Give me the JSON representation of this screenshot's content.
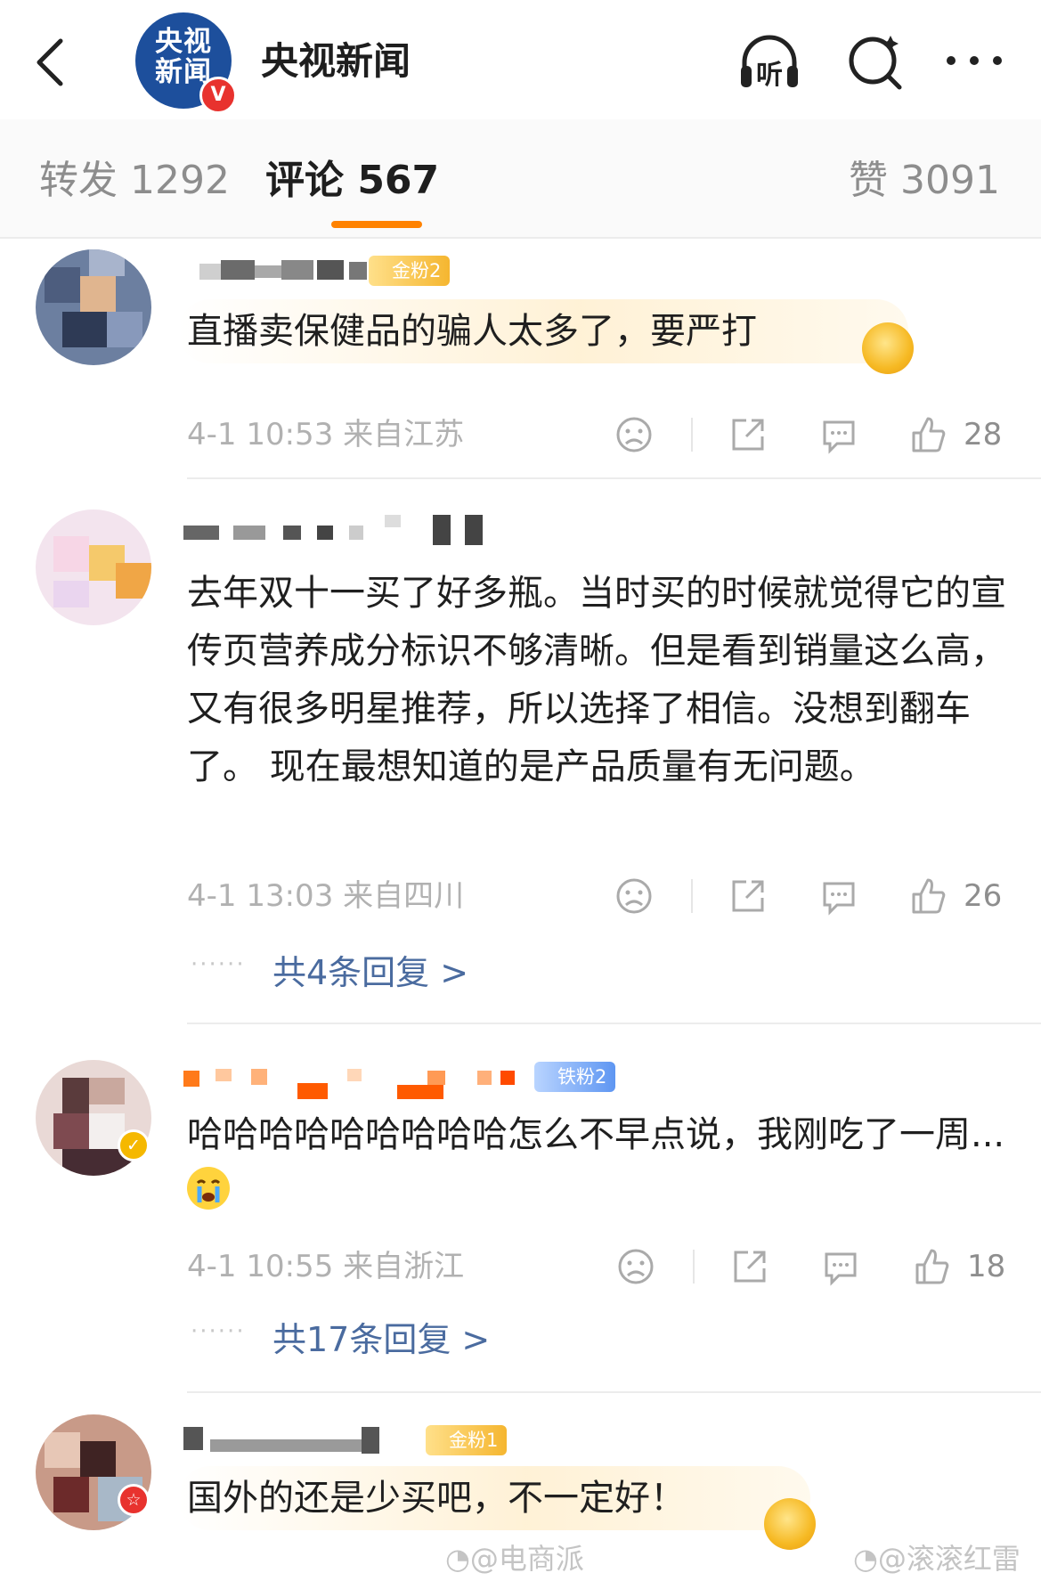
{
  "header": {
    "logo_text_line1": "央视",
    "logo_text_line2": "新闻",
    "verified_mark": "V",
    "channel_name": "央视新闻",
    "listen_label": "听"
  },
  "tabs": {
    "repost": "转发 1292",
    "comments": "评论 567",
    "likes": "赞 3091"
  },
  "comments": [
    {
      "fan_badge": "金粉2",
      "text": "直播卖保健品的骗人太多了，要严打",
      "meta": "4-1 10:53  来自江苏",
      "likes": "28"
    },
    {
      "text": "去年双十一买了好多瓶。当时买的时候就觉得它的宣传页营养成分标识不够清晰。但是看到销量这么高，又有很多明星推荐，所以选择了相信。没想到翻车了。 现在最想知道的是产品质量有无问题。",
      "meta": "4-1 13:03  来自四川",
      "likes": "26",
      "replies": "共4条回复 >"
    },
    {
      "fan_badge": "铁粉2",
      "text": "哈哈哈哈哈哈哈哈哈怎么不早点说，我刚吃了一周...",
      "meta": "4-1 10:55  来自浙江",
      "likes": "18",
      "replies": "共17条回复 >"
    },
    {
      "fan_badge": "金粉1",
      "text": "国外的还是少买吧，不一定好！"
    }
  ],
  "watermarks": [
    "@电商派",
    "@滚滚红雷"
  ],
  "icons": [
    "back-icon",
    "listen-icon",
    "search-icon",
    "more-icon",
    "dislike-icon",
    "repost-icon",
    "reply-icon",
    "like-icon",
    "medal-icon",
    "crying-emoji-icon",
    "weibo-icon"
  ],
  "colors": {
    "accent": "#ff8200",
    "link": "#4a6b9f",
    "brand_blue": "#1d4f9c",
    "verified_red": "#e8322e"
  }
}
